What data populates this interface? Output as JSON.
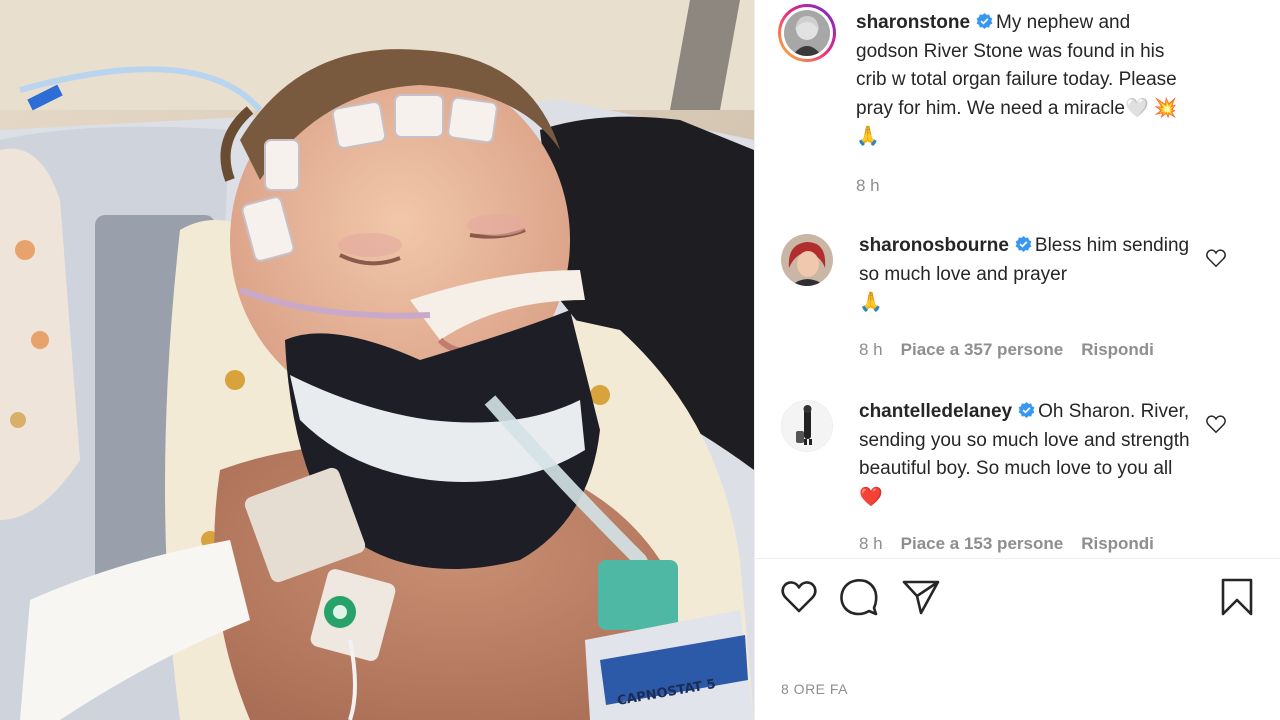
{
  "post": {
    "author": "sharonstone",
    "caption": "My nephew and godson River Stone was found in his crib w total organ failure today. Please pray for him. We need a miracle",
    "caption_emoji": "🤍 💥 🙏",
    "time": "8 h"
  },
  "comments": [
    {
      "user": "sharonosbourne",
      "text": "Bless him sending so much love and prayer",
      "emoji": "🙏",
      "time": "8 h",
      "likes": "Piace a 357 persone",
      "reply": "Rispondi"
    },
    {
      "user": "chantelledelaney",
      "text": "Oh Sharon. River, sending you so much love and strength beautiful boy. So much love to you all",
      "emoji": "❤️",
      "time": "8 h",
      "likes": "Piace a 153 persone",
      "reply": "Rispondi"
    }
  ],
  "footer": {
    "time_ago": "8 ORE FA"
  },
  "icons": {
    "like": "heart-icon",
    "comment": "comment-icon",
    "share": "send-icon",
    "save": "bookmark-icon",
    "verified": "verified-badge-icon"
  },
  "colors": {
    "verified": "#3897f0",
    "text": "#262626",
    "muted": "#8e8e8e",
    "heart": "#ed4956"
  }
}
